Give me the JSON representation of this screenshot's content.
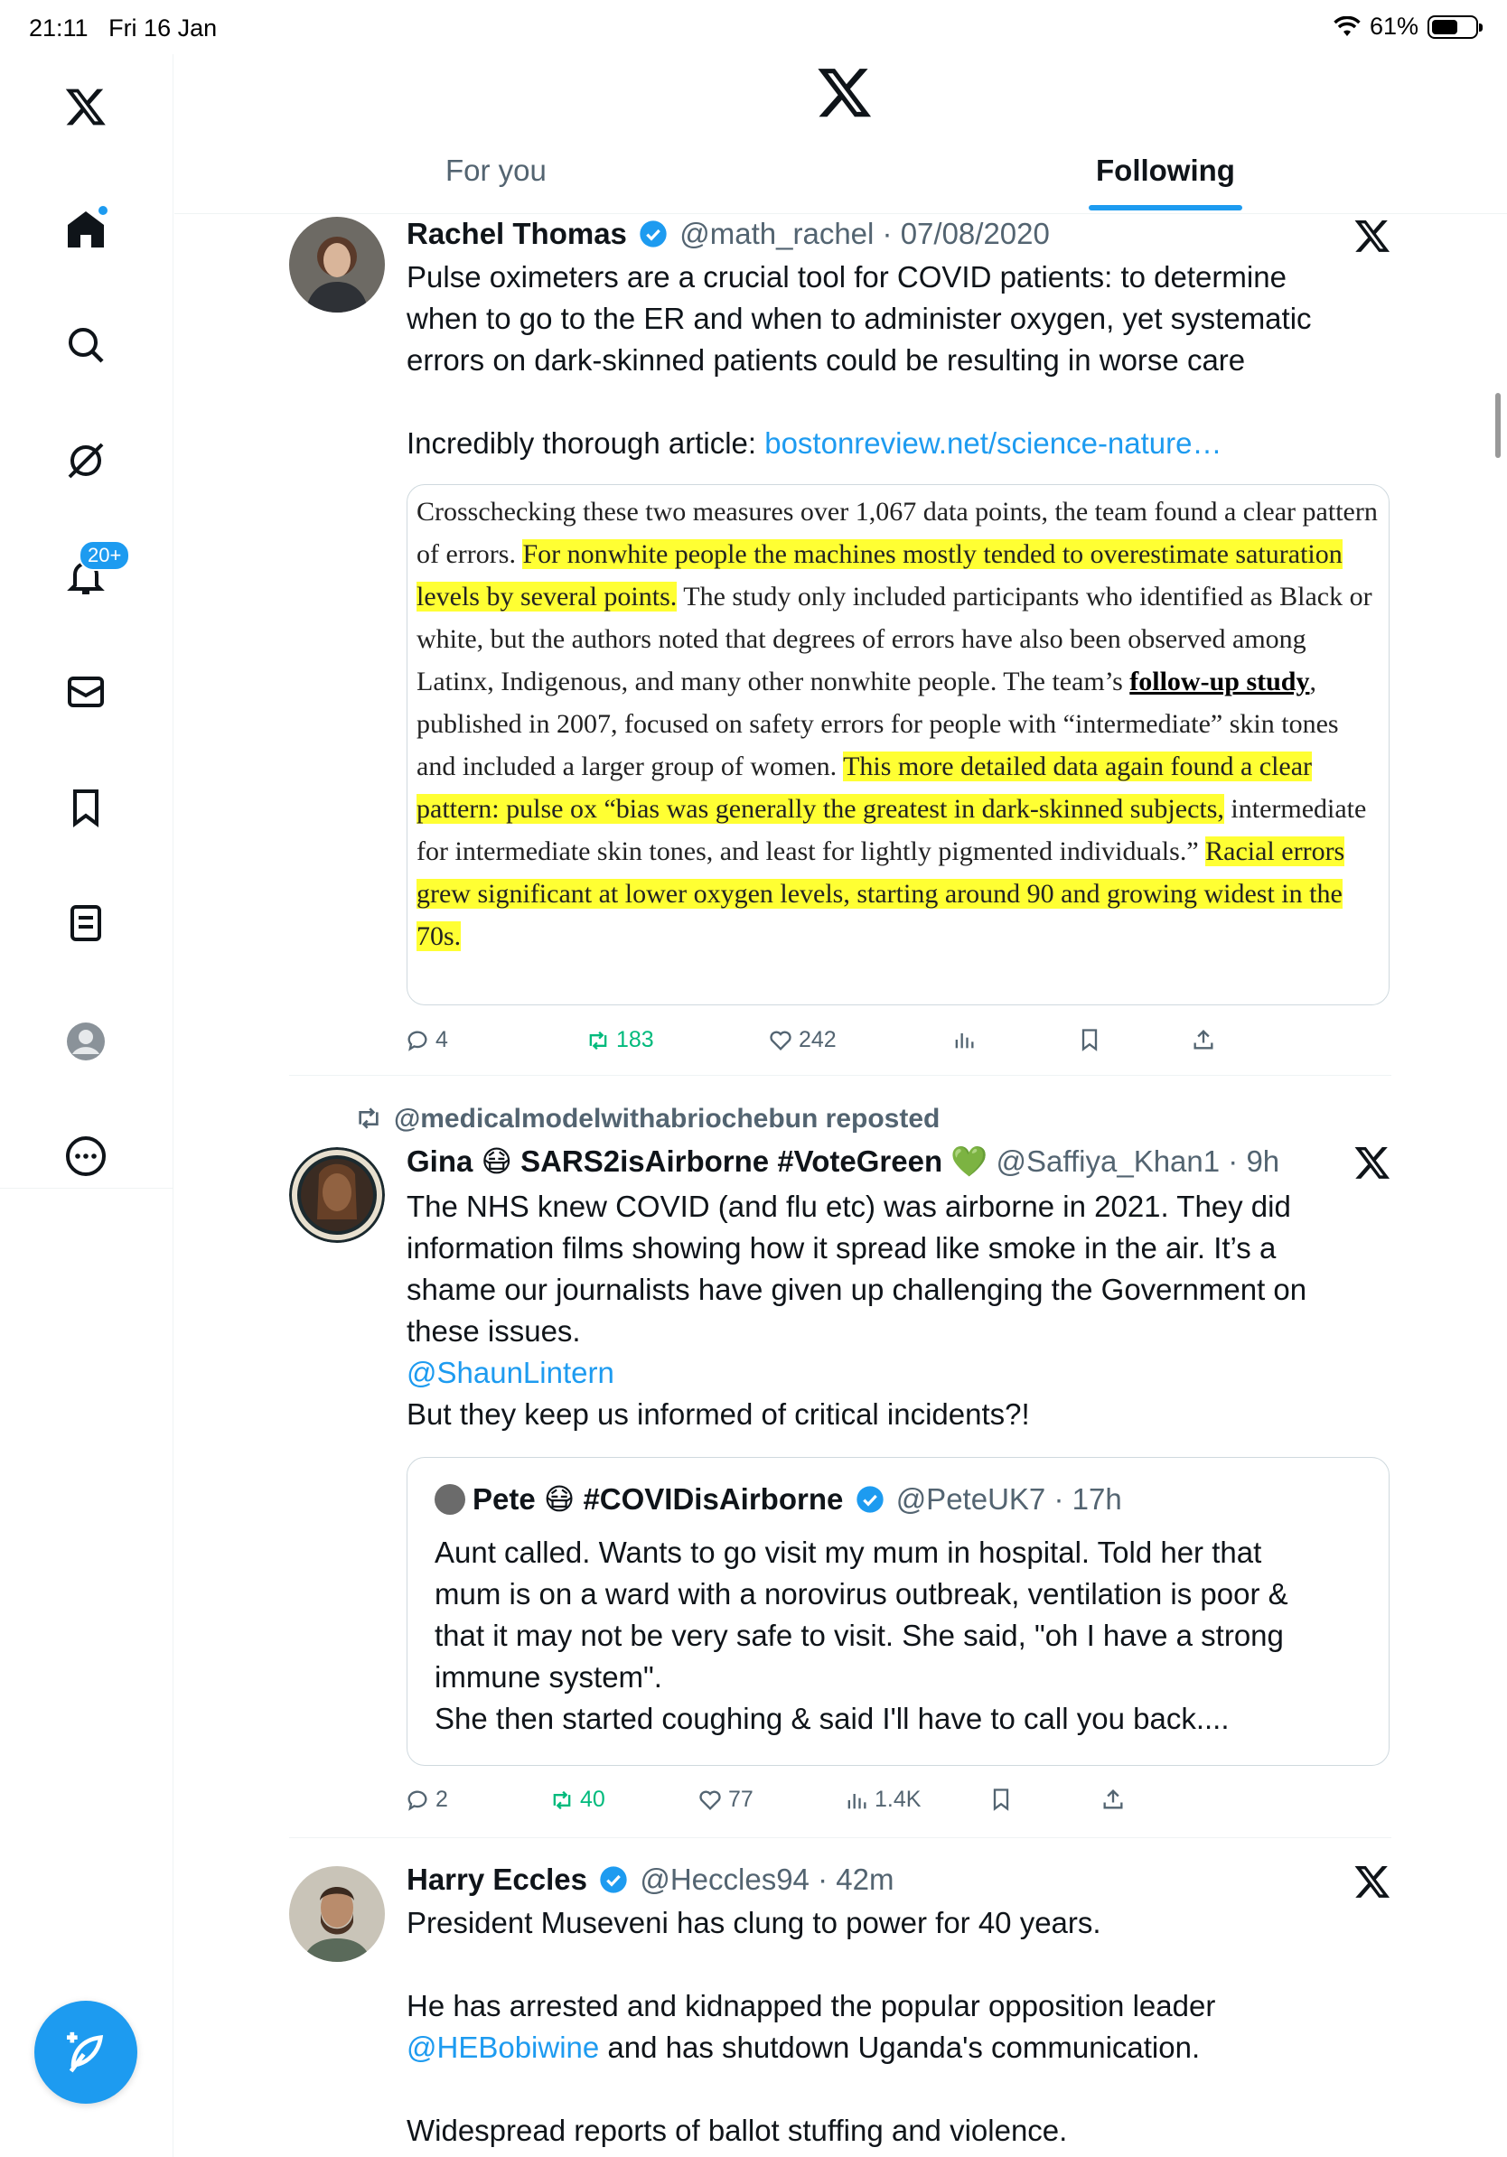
{
  "status_bar": {
    "time": "21:11",
    "date": "Fri 16 Jan",
    "battery": "61%",
    "battery_level": 0.61
  },
  "sidebar": {
    "items": [
      {
        "icon": "x-logo-icon"
      },
      {
        "icon": "home-icon",
        "has_dot": true
      },
      {
        "icon": "search-icon"
      },
      {
        "icon": "grok-icon"
      },
      {
        "icon": "notifications-icon",
        "badge": "20+"
      },
      {
        "icon": "messages-icon"
      },
      {
        "icon": "bookmarks-icon"
      },
      {
        "icon": "lists-icon"
      },
      {
        "icon": "profile-icon"
      },
      {
        "icon": "more-icon"
      }
    ],
    "compose_icon": "compose-icon"
  },
  "header": {
    "tabs": [
      {
        "label": "For you"
      },
      {
        "label": "Following",
        "active": true
      }
    ]
  },
  "tweets": [
    {
      "name": "Rachel Thomas",
      "handle": "@math_rachel",
      "time": "· 07/08/2020",
      "body_lines": [
        "Pulse oximeters are a crucial tool for COVID patients: to determine",
        "when to go to the ER and when to administer oxygen, yet systematic",
        "errors on dark-skinned patients could be resulting in worse care"
      ],
      "body_prefix": "Incredibly thorough article: ",
      "body_link": "bostonreview.net/science-nature…",
      "article": {
        "p1": "Crosschecking these two measures over 1,067 data points, the team found a clear pattern of errors. ",
        "h1": "For nonwhite people the machines mostly tended to overestimate saturation levels by several points.",
        "p2": " The study only included participants who identified as Black or white, but the authors noted that degrees of errors have also been observed among Latinx, Indigenous, and many other nonwhite people. The team’s ",
        "link": "follow-up study",
        "p3": ", published in 2007, focused on safety errors for people with “intermediate” skin tones and included a larger group of women. ",
        "h2": "This more detailed data again found a clear pattern: pulse ox “bias was generally the greatest in dark-skinned subjects,",
        "p4": " intermediate for intermediate skin tones, and least for lightly pigmented individuals.” ",
        "h3": "Racial errors grew significant at lower oxygen levels, starting around 90 and growing widest in the 70s."
      },
      "actions": {
        "replies": "4",
        "reposts": "183",
        "likes": "242",
        "views": ""
      }
    },
    {
      "repost_by": "@medicalmodelwithabriochebun reposted",
      "name": "Gina 😷 SARS2isAirborne #VoteGreen 💚",
      "handle": "@Saffiya_Khan1",
      "time": "· 9h",
      "body_lines": [
        "The NHS knew COVID (and flu etc) was airborne in 2021. They did",
        "information films showing how it spread like smoke in the air. It’s a",
        "shame our journalists have given up challenging the Government on",
        "these issues."
      ],
      "mention": "@ShaunLintern",
      "body_after": "But they  keep us informed of critical incidents?!",
      "quote": {
        "name": "Pete 😷 #COVIDisAirborne",
        "handle": "@PeteUK7",
        "time": "· 17h",
        "lines": [
          "Aunt called. Wants to go visit my mum in hospital. Told her that",
          "mum is on a ward with a norovirus outbreak, ventilation is poor &",
          "that it may not be very safe to visit. She said, \"oh I have a strong",
          "immune system\".",
          "She then started coughing & said I'll have to call you back...."
        ]
      },
      "actions": {
        "replies": "2",
        "reposts": "40",
        "likes": "77",
        "views": "1.4K"
      }
    },
    {
      "name": "Harry Eccles",
      "handle": "@Heccles94",
      "time": "· 42m",
      "line1": "President Museveni has clung to power for 40 years.",
      "line2": "He has arrested and kidnapped the popular opposition leader",
      "mention": "@HEBobiwine",
      "line3_after": " and has shutdown Uganda's communication.",
      "line4": "Widespread reports of ballot stuffing and violence."
    }
  ]
}
